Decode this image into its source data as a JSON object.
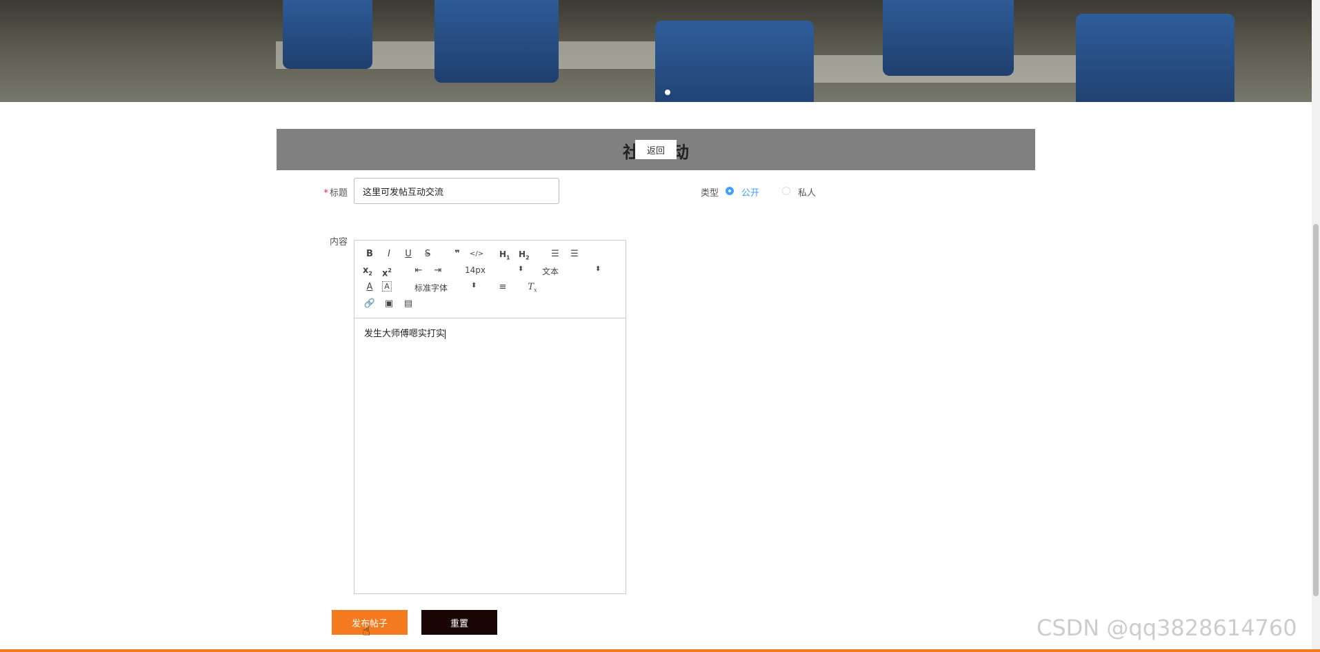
{
  "page": {
    "header_title": "社区互动",
    "back_label": "返回"
  },
  "form": {
    "title_label": "标题",
    "title_value": "这里可发帖互动交流",
    "type_label": "类型",
    "type_options": [
      "公开",
      "私人"
    ],
    "type_selected": "公开",
    "content_label": "内容",
    "content_value": "发生大师傅嗯实打实",
    "submit_label": "发布帖子",
    "reset_label": "重置"
  },
  "editor_toolbar": {
    "font_size": "14px",
    "block_format": "文本",
    "font_family": "标准字体"
  },
  "watermark": "CSDN @qq3828614760",
  "colors": {
    "accent": "#f47a20",
    "header_bar": "#808080",
    "radio_selected": "#409eff",
    "reset_button": "#1a0505"
  }
}
